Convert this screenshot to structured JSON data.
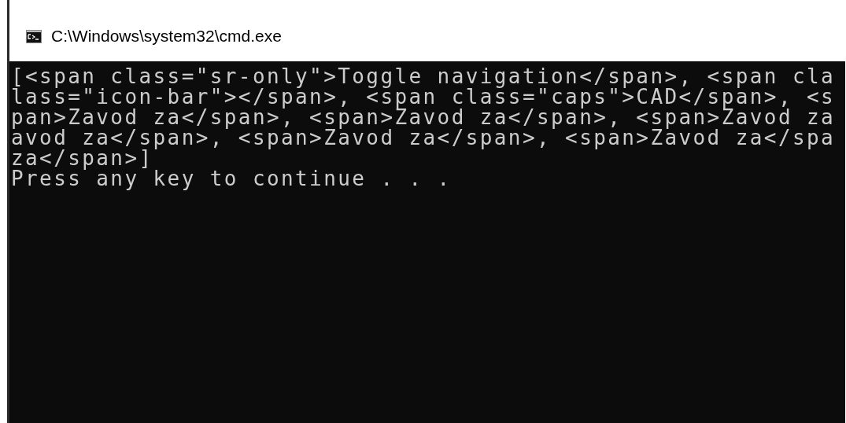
{
  "window": {
    "title": "C:\\Windows\\system32\\cmd.exe"
  },
  "console": {
    "lines": [
      "[<span class=\"sr-only\">Toggle navigation</span>, <span cla",
      "lass=\"icon-bar\"></span>, <span class=\"caps\">CAD</span>, <s",
      "pan>Zavod za</span>, <span>Zavod za</span>, <span>Zavod za",
      "avod za</span>, <span>Zavod za</span>, <span>Zavod za</spa",
      "za</span>]",
      "Press any key to continue . . ."
    ]
  }
}
